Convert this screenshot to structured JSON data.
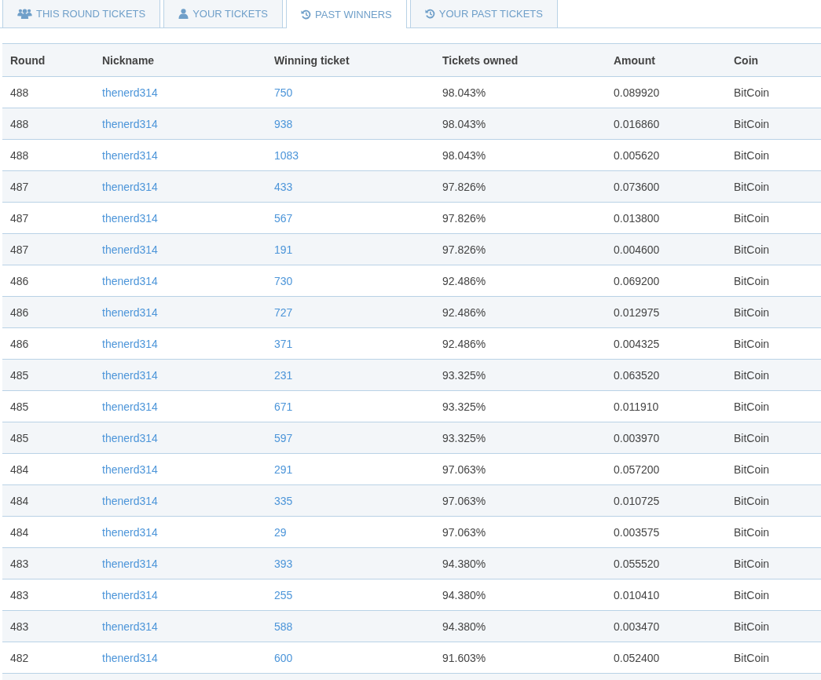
{
  "tabs": [
    {
      "label": "THIS ROUND TICKETS",
      "kind": "group",
      "selected": false
    },
    {
      "label": "YOUR TICKETS",
      "kind": "own",
      "selected": false
    },
    {
      "label": "PAST WINNERS",
      "kind": "past",
      "selected": true
    },
    {
      "label": "YOUR PAST TICKETS",
      "kind": "past",
      "selected": false
    }
  ],
  "table": {
    "columns": [
      "Round",
      "Nickname",
      "Winning ticket",
      "Tickets owned",
      "Amount",
      "Coin"
    ],
    "rows": [
      [
        "488",
        "thenerd314",
        "750",
        "98.043%",
        "0.089920",
        "BitCoin"
      ],
      [
        "488",
        "thenerd314",
        "938",
        "98.043%",
        "0.016860",
        "BitCoin"
      ],
      [
        "488",
        "thenerd314",
        "1083",
        "98.043%",
        "0.005620",
        "BitCoin"
      ],
      [
        "487",
        "thenerd314",
        "433",
        "97.826%",
        "0.073600",
        "BitCoin"
      ],
      [
        "487",
        "thenerd314",
        "567",
        "97.826%",
        "0.013800",
        "BitCoin"
      ],
      [
        "487",
        "thenerd314",
        "191",
        "97.826%",
        "0.004600",
        "BitCoin"
      ],
      [
        "486",
        "thenerd314",
        "730",
        "92.486%",
        "0.069200",
        "BitCoin"
      ],
      [
        "486",
        "thenerd314",
        "727",
        "92.486%",
        "0.012975",
        "BitCoin"
      ],
      [
        "486",
        "thenerd314",
        "371",
        "92.486%",
        "0.004325",
        "BitCoin"
      ],
      [
        "485",
        "thenerd314",
        "231",
        "93.325%",
        "0.063520",
        "BitCoin"
      ],
      [
        "485",
        "thenerd314",
        "671",
        "93.325%",
        "0.011910",
        "BitCoin"
      ],
      [
        "485",
        "thenerd314",
        "597",
        "93.325%",
        "0.003970",
        "BitCoin"
      ],
      [
        "484",
        "thenerd314",
        "291",
        "97.063%",
        "0.057200",
        "BitCoin"
      ],
      [
        "484",
        "thenerd314",
        "335",
        "97.063%",
        "0.010725",
        "BitCoin"
      ],
      [
        "484",
        "thenerd314",
        "29",
        "97.063%",
        "0.003575",
        "BitCoin"
      ],
      [
        "483",
        "thenerd314",
        "393",
        "94.380%",
        "0.055520",
        "BitCoin"
      ],
      [
        "483",
        "thenerd314",
        "255",
        "94.380%",
        "0.010410",
        "BitCoin"
      ],
      [
        "483",
        "thenerd314",
        "588",
        "94.380%",
        "0.003470",
        "BitCoin"
      ],
      [
        "482",
        "thenerd314",
        "600",
        "91.603%",
        "0.052400",
        "BitCoin"
      ]
    ]
  }
}
